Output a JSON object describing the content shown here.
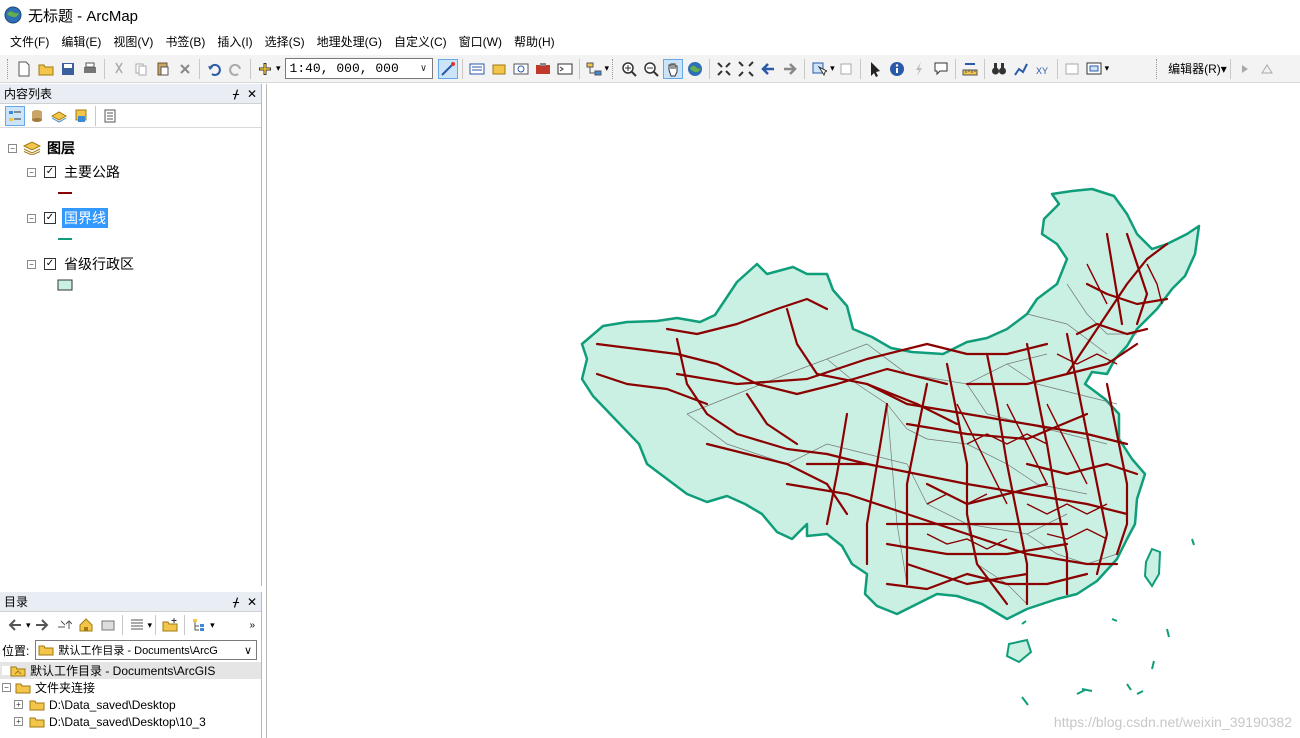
{
  "window": {
    "title": "无标题 - ArcMap"
  },
  "menu": [
    "文件(F)",
    "编辑(E)",
    "视图(V)",
    "书签(B)",
    "插入(I)",
    "选择(S)",
    "地理处理(G)",
    "自定义(C)",
    "窗口(W)",
    "帮助(H)"
  ],
  "toolbar": {
    "scale": "1:40, 000, 000",
    "editor_label": "编辑器(R)▾"
  },
  "toc": {
    "title": "内容列表",
    "root_label": "图层",
    "layers": [
      {
        "label": "主要公路",
        "checked": true,
        "symbol_color": "#8b0000"
      },
      {
        "label": "国界线",
        "checked": true,
        "symbol_color": "#0f9d7a",
        "selected": true
      },
      {
        "label": "省级行政区",
        "checked": true,
        "symbol_color": "#c9f0e3"
      }
    ]
  },
  "catalog": {
    "title": "目录",
    "location_label": "位置:",
    "location_value": "默认工作目录 - Documents\\ArcG",
    "items": [
      "默认工作目录 - Documents\\ArcGIS",
      "文件夹连接",
      "D:\\Data_saved\\Desktop",
      "D:\\Data_saved\\Desktop\\10_3"
    ]
  },
  "map": {
    "fill_color": "#c9f0e3",
    "border_color": "#0f9d7a",
    "road_color": "#8b0000"
  },
  "watermark": "https://blog.csdn.net/weixin_39190382"
}
